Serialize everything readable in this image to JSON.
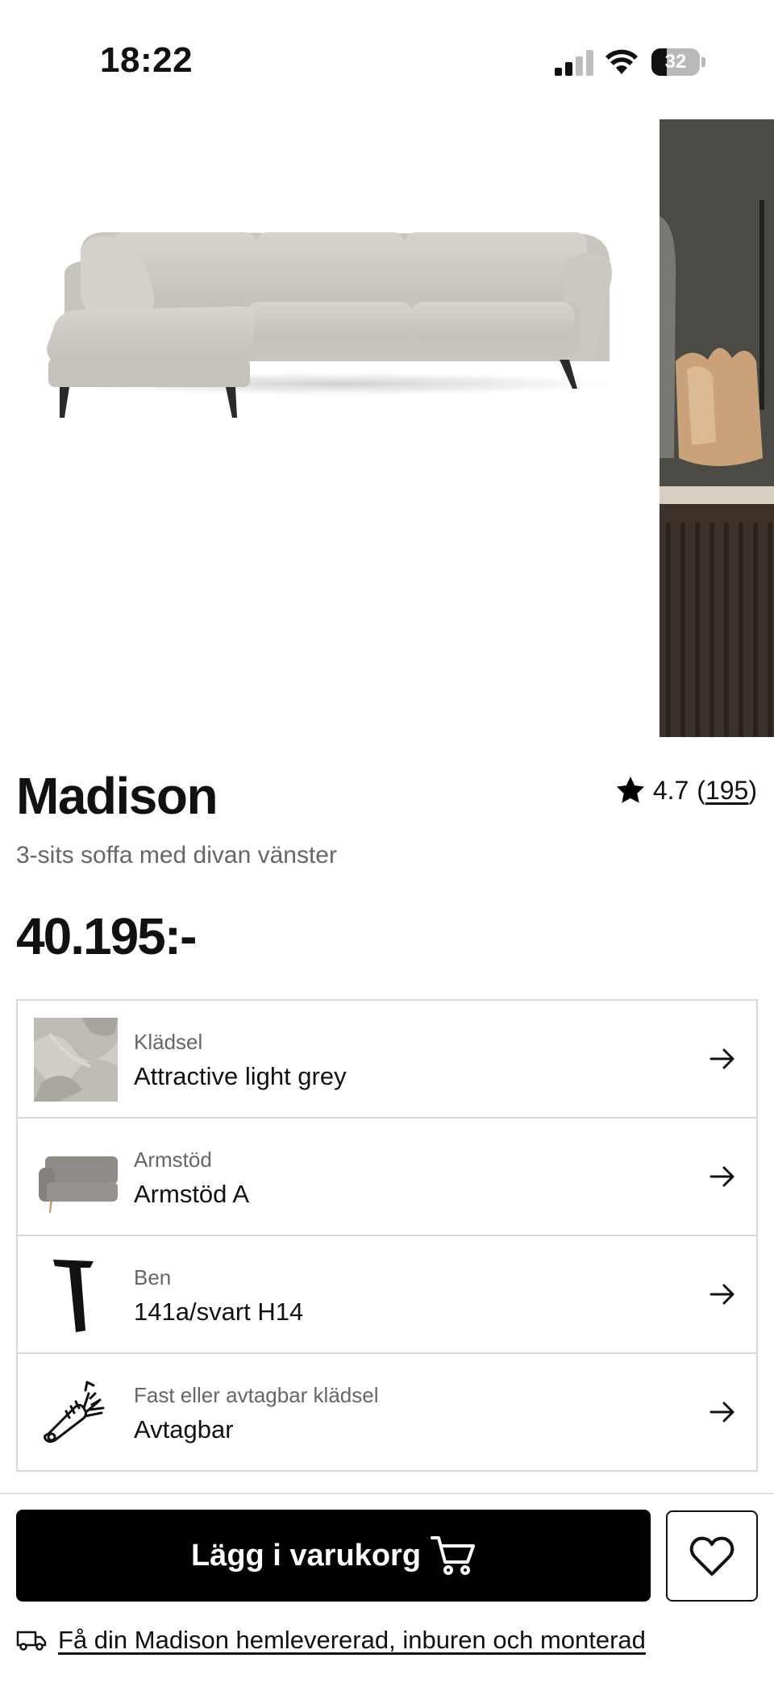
{
  "status_bar": {
    "time": "18:22",
    "battery": "32",
    "battery_level": 0.32
  },
  "product": {
    "title": "Madison",
    "subtitle": "3-sits soffa med divan vänster",
    "price": "40.195:-",
    "rating": {
      "score": "4.7",
      "count": "195",
      "open": "(",
      "close": ")"
    }
  },
  "options": [
    {
      "label": "Klädsel",
      "value": "Attractive light grey",
      "thumb": "fabric-swatch"
    },
    {
      "label": "Armstöd",
      "value": "Armstöd A",
      "thumb": "armrest-sofa"
    },
    {
      "label": "Ben",
      "value": "141a/svart H14",
      "thumb": "sofa-leg"
    },
    {
      "label": "Fast eller avtagbar klädsel",
      "value": "Avtagbar",
      "thumb": "zipper-icon"
    }
  ],
  "actions": {
    "add_to_cart": "Lägg i varukorg"
  },
  "delivery": {
    "text": "Få din Madison hemlevererad, inburen och monterad"
  },
  "colors": {
    "button": "#000000",
    "border": "#d8d8d8",
    "muted_text": "#666666",
    "sofa": "#cfcdc6"
  }
}
